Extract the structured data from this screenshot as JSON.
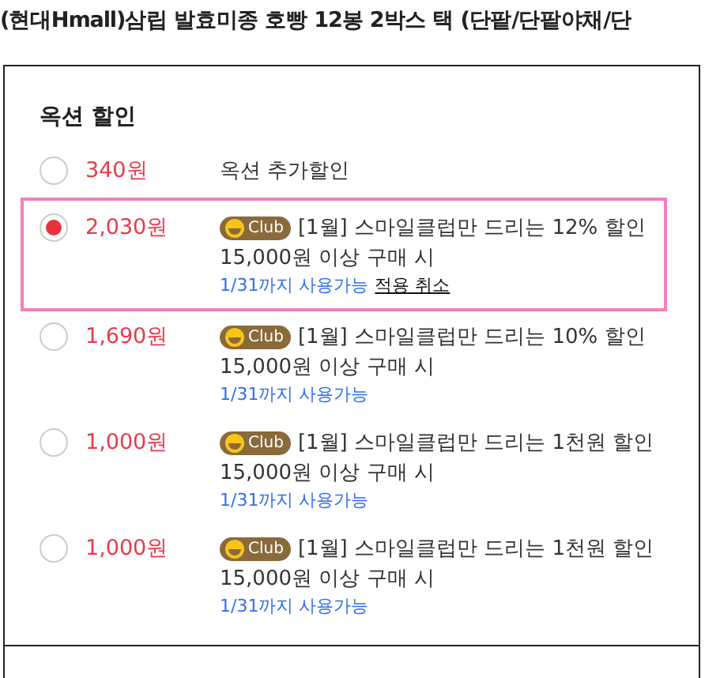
{
  "product_title": "(현대Hmall)삼립 발효미종 호빵 12봉 2박스 택 (단팥/단팥야채/단",
  "discount_section": {
    "heading": "옥션 할인",
    "options": [
      {
        "selected": false,
        "price": "340원",
        "label": "옥션 추가할인"
      },
      {
        "selected": true,
        "price": "2,030원",
        "badge": "Club",
        "label": "[1월] 스마일클럽만 드리는 12% 할인",
        "condition": "15,000원 이상 구매 시",
        "validity": "1/31까지 사용가능",
        "cancel_link": "적용 취소"
      },
      {
        "selected": false,
        "price": "1,690원",
        "badge": "Club",
        "label": "[1월] 스마일클럽만 드리는 10% 할인",
        "condition": "15,000원 이상 구매 시",
        "validity": "1/31까지 사용가능"
      },
      {
        "selected": false,
        "price": "1,000원",
        "badge": "Club",
        "label": "[1월] 스마일클럽만 드리는 1천원 할인",
        "condition": "15,000원 이상 구매 시",
        "validity": "1/31까지 사용가능"
      },
      {
        "selected": false,
        "price": "1,000원",
        "badge": "Club",
        "label": "[1월] 스마일클럽만 드리는 1천원 할인",
        "condition": "15,000원 이상 구매 시",
        "validity": "1/31까지 사용가능"
      }
    ]
  }
}
